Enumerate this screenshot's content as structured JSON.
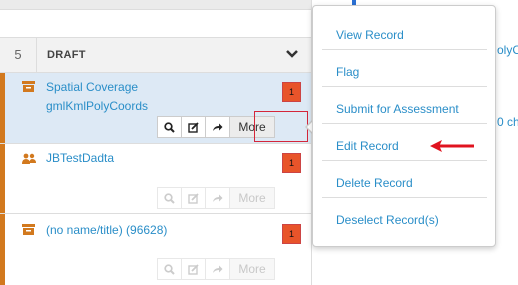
{
  "list": {
    "column_number": "5",
    "column_title": "DRAFT",
    "chevron_glyph": "❯"
  },
  "records": [
    {
      "title_line1": "Spatial Coverage",
      "title_line2": "gmlKmlPolyCoords",
      "badge": "1",
      "icon": "archive-icon",
      "actions": {
        "view": "search-icon",
        "edit": "edit-icon",
        "share": "share-arrow-icon",
        "more_label": "More"
      },
      "enabled": true
    },
    {
      "title_line1": "JBTestDadta",
      "badge": "1",
      "icon": "users-icon",
      "actions": {
        "more_label": "More"
      },
      "enabled": false
    },
    {
      "title_line1": "(no name/title) (96628)",
      "badge": "1",
      "icon": "archive-icon",
      "actions": {
        "more_label": "More"
      },
      "enabled": false
    }
  ],
  "right_panel": {
    "fragment_1": "olyC",
    "fragment_2": "0 ch"
  },
  "dropdown": {
    "items": [
      "View Record",
      "Flag",
      "Submit for Assessment",
      "Edit Record",
      "Delete Record",
      "Deselect Record(s)"
    ]
  },
  "colors": {
    "accent_orange": "#d2791e",
    "link_blue": "#2a8ec8",
    "badge_red": "#e8542a",
    "highlight_red": "#d4263a",
    "arrow_red": "#e0131f"
  }
}
